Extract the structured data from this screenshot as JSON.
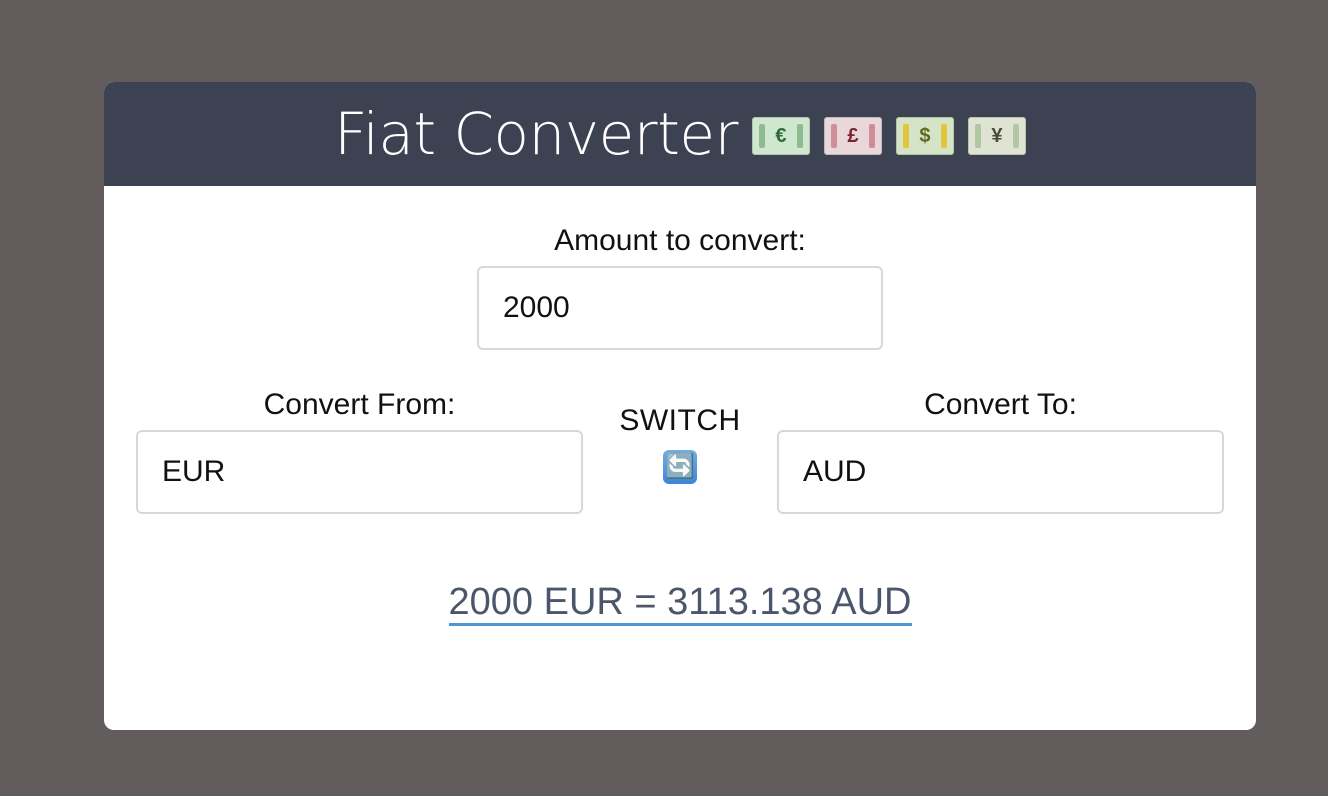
{
  "header": {
    "title": "Fiat Converter",
    "bill_icons": [
      {
        "symbol": "€",
        "name": "euro-banknote-icon"
      },
      {
        "symbol": "£",
        "name": "pound-banknote-icon"
      },
      {
        "symbol": "$",
        "name": "dollar-banknote-icon"
      },
      {
        "symbol": "¥",
        "name": "yen-banknote-icon"
      }
    ]
  },
  "amount": {
    "label": "Amount to convert:",
    "value": "2000"
  },
  "from": {
    "label": "Convert From:",
    "value": "EUR"
  },
  "to": {
    "label": "Convert To:",
    "value": "AUD"
  },
  "switch": {
    "label": "SWITCH",
    "icon": "🔄"
  },
  "result": {
    "text": "2000 EUR = 3113.138 AUD"
  },
  "colors": {
    "page_background": "#625d5c",
    "header_background": "#3c4252",
    "result_text": "#4c566a",
    "result_underline": "#4d97d6"
  }
}
